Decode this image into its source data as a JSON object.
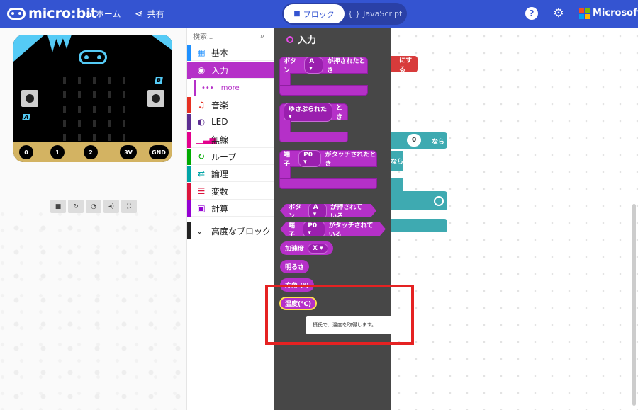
{
  "header": {
    "logo_text": "micro:bit",
    "home_label": "ホーム",
    "share_label": "共有",
    "toggle_blocks": "ブロック",
    "toggle_js": "JavaScript",
    "brand": "Microsoft"
  },
  "simulator": {
    "button_a": "A",
    "button_b": "B",
    "pins": [
      "0",
      "1",
      "2",
      "3V",
      "GND"
    ]
  },
  "toolbox": {
    "search_placeholder": "検索...",
    "categories": [
      {
        "label": "基本",
        "color": "#1e90ff"
      },
      {
        "label": "入力",
        "color": "#b530c8"
      },
      {
        "label": "音楽",
        "color": "#e63022"
      },
      {
        "label": "LED",
        "color": "#5c2d91"
      },
      {
        "label": "無線",
        "color": "#e3008c"
      },
      {
        "label": "ループ",
        "color": "#00aa00"
      },
      {
        "label": "論理",
        "color": "#00a4a6"
      },
      {
        "label": "変数",
        "color": "#dc143c"
      },
      {
        "label": "計算",
        "color": "#9400d3"
      }
    ],
    "more_label": "more",
    "advanced_label": "高度なブロック"
  },
  "flyout": {
    "title": "入力",
    "blocks": {
      "button_pressed": {
        "prefix": "ボタン",
        "value": "A",
        "suffix": "が押されたとき"
      },
      "gesture": {
        "value": "ゆさぶられた",
        "suffix": "とき"
      },
      "pin_touched": {
        "prefix": "端子",
        "value": "P0",
        "suffix": "がタッチされたとき"
      },
      "is_button_pressed": {
        "prefix": "ボタン",
        "value": "A",
        "suffix": "が押されている"
      },
      "is_pin_touched": {
        "prefix": "端子",
        "value": "P0",
        "suffix": "がタッチされている"
      },
      "acceleration": {
        "prefix": "加速度",
        "value": "X"
      },
      "brightness": "明るさ",
      "compass": "方角 (°)",
      "temperature": "温度(℃)"
    }
  },
  "workspace": {
    "red_block_text": "にする",
    "value_zero": "0",
    "if_text": "なら",
    "else_text": "なら"
  },
  "tooltip": {
    "text": "摂氏で、温度を取得します。"
  },
  "colors": {
    "header": "#3454d1",
    "input_category": "#b530c8",
    "flyout_bg": "#474747",
    "highlight": "#e52222"
  }
}
